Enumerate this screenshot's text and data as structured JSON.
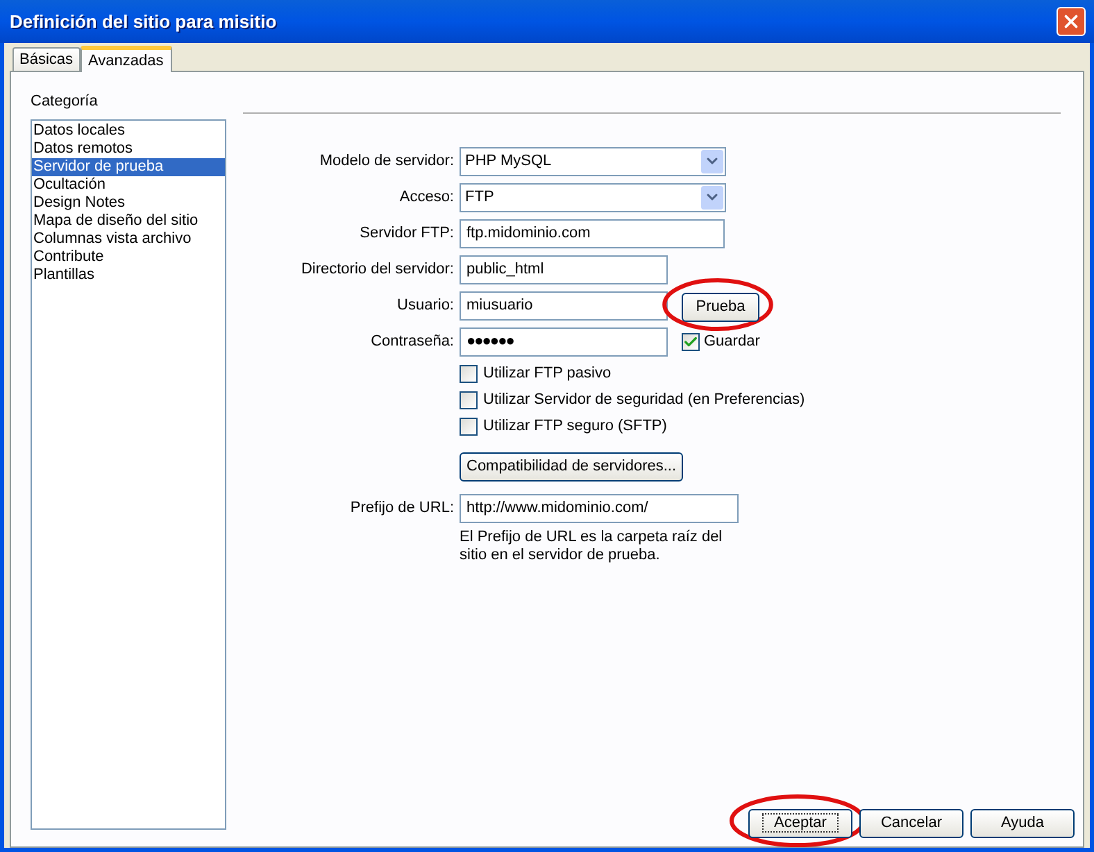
{
  "window": {
    "title": "Definición del sitio para misitio"
  },
  "tabs": [
    {
      "label": "Básicas",
      "selected": false
    },
    {
      "label": "Avanzadas",
      "selected": true
    }
  ],
  "category": {
    "label": "Categoría",
    "items": [
      {
        "label": "Datos locales",
        "selected": false
      },
      {
        "label": "Datos remotos",
        "selected": false
      },
      {
        "label": "Servidor de prueba",
        "selected": true
      },
      {
        "label": "Ocultación",
        "selected": false
      },
      {
        "label": "Design Notes",
        "selected": false
      },
      {
        "label": "Mapa de diseño del sitio",
        "selected": false
      },
      {
        "label": "Columnas vista archivo",
        "selected": false
      },
      {
        "label": "Contribute",
        "selected": false
      },
      {
        "label": "Plantillas",
        "selected": false
      }
    ]
  },
  "form": {
    "rows": [
      {
        "kind": "select",
        "label": "Modelo de servidor:",
        "value": "PHP MySQL"
      },
      {
        "kind": "select",
        "label": "Acceso:",
        "value": "FTP"
      },
      {
        "kind": "text",
        "label": "Servidor FTP:",
        "value": "ftp.midominio.com"
      },
      {
        "kind": "text",
        "label": "Directorio del servidor:",
        "value": "public_html"
      },
      {
        "kind": "text",
        "label": "Usuario:",
        "value": "miusuario",
        "button": {
          "label": "Prueba",
          "highlighted": true
        }
      },
      {
        "kind": "password",
        "label": "Contraseña:",
        "value": "●●●●●●",
        "checkbox": {
          "label": "Guardar",
          "checked": true
        }
      }
    ],
    "options": [
      {
        "label": "Utilizar FTP pasivo",
        "checked": false
      },
      {
        "label": "Utilizar Servidor de seguridad (en Preferencias)",
        "checked": false
      },
      {
        "label": "Utilizar FTP seguro (SFTP)",
        "checked": false
      }
    ],
    "compat_button": "Compatibilidad de servidores...",
    "url": {
      "label": "Prefijo de URL:",
      "value": "http://www.midominio.com/"
    },
    "note": "El Prefijo de URL es la carpeta raíz del\nsitio en el servidor de prueba."
  },
  "buttons": [
    {
      "label": "Aceptar",
      "highlighted": true,
      "focused": true
    },
    {
      "label": "Cancelar",
      "highlighted": false,
      "focused": false
    },
    {
      "label": "Ayuda",
      "highlighted": false,
      "focused": false
    }
  ]
}
